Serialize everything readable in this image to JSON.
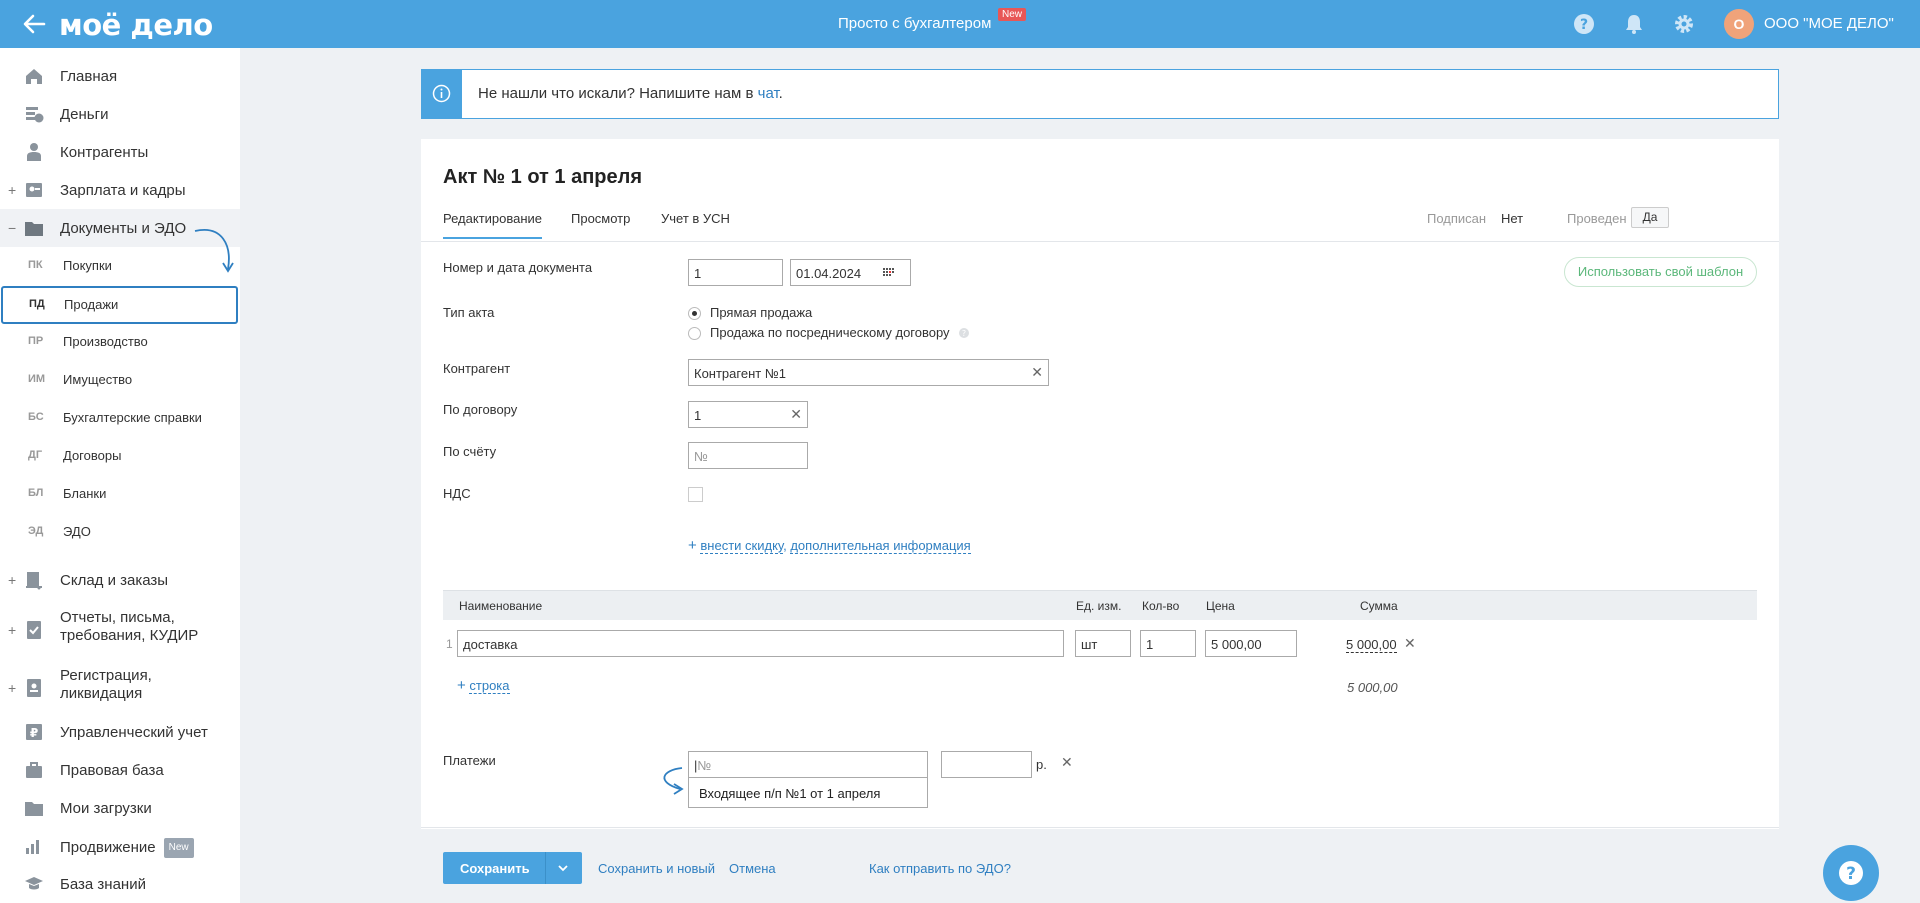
{
  "header": {
    "logo": "моё дело",
    "center_title": "Просто с бухгалтером",
    "new_badge": "New",
    "org_initial": "О",
    "org_name": "ООО \"МОЕ ДЕЛО\"",
    "icons": [
      "back-arrow-icon",
      "help-icon",
      "bell-icon",
      "gear-icon"
    ]
  },
  "sidebar": {
    "items": [
      {
        "label": "Главная",
        "icon": "home-icon"
      },
      {
        "label": "Деньги",
        "icon": "money-icon"
      },
      {
        "label": "Контрагенты",
        "icon": "contractors-icon"
      },
      {
        "label": "Зарплата и кадры",
        "icon": "salary-icon",
        "expand": "+"
      },
      {
        "label": "Документы и ЭДО",
        "icon": "documents-icon",
        "expand": "−"
      }
    ],
    "sub_items": [
      {
        "abbr": "ПК",
        "label": "Покупки"
      },
      {
        "abbr": "ПД",
        "label": "Продажи"
      },
      {
        "abbr": "ПР",
        "label": "Производство"
      },
      {
        "abbr": "ИМ",
        "label": "Имущество"
      },
      {
        "abbr": "БС",
        "label": "Бухгалтерские справки"
      },
      {
        "abbr": "ДГ",
        "label": "Договоры"
      },
      {
        "abbr": "БЛ",
        "label": "Бланки"
      },
      {
        "abbr": "ЭД",
        "label": "ЭДО"
      }
    ],
    "items2": [
      {
        "label": "Склад и заказы",
        "icon": "warehouse-icon",
        "expand": "+"
      },
      {
        "label": "Отчеты, письма,",
        "label2": "требования, КУДИР",
        "icon": "reports-icon",
        "expand": "+"
      },
      {
        "label": "Регистрация,",
        "label2": "ликвидация",
        "icon": "registration-icon",
        "expand": "+"
      },
      {
        "label": "Управленческий учет",
        "icon": "management-icon"
      },
      {
        "label": "Правовая база",
        "icon": "briefcase-icon"
      },
      {
        "label": "Мои загрузки",
        "icon": "folder-icon"
      },
      {
        "label": "Продвижение",
        "icon": "promotion-icon",
        "badge": "New"
      },
      {
        "label": "База знаний",
        "icon": "graduation-icon"
      }
    ]
  },
  "banner": {
    "text": "Не нашли что искали? Напишите нам в ",
    "link": "чат",
    "end": "."
  },
  "document": {
    "title": "Акт № 1 от 1 апреля",
    "tabs": [
      "Редактирование",
      "Просмотр",
      "Учет в УСН"
    ],
    "signed_label": "Подписан",
    "signed_value": "Нет",
    "posted_label": "Проведен",
    "posted_value": "Да",
    "template_button": "Использовать свой шаблон"
  },
  "form": {
    "number_date_label": "Номер и дата документа",
    "number_value": "1",
    "date_value": "01.04.2024",
    "act_type_label": "Тип акта",
    "act_type_options": [
      "Прямая продажа",
      "Продажа по посредническому договору"
    ],
    "act_type_selected": 0,
    "contractor_label": "Контрагент",
    "contractor_value": "Контрагент №1",
    "contract_label": "По договору",
    "contract_value": "1",
    "invoice_label": "По счёту",
    "invoice_placeholder": "№",
    "vat_label": "НДС",
    "discount_link": "внести скидку",
    "info_link": "дополнительная информация"
  },
  "table": {
    "headers": [
      "Наименование",
      "Ед. изм.",
      "Кол-во",
      "Цена",
      "Сумма"
    ],
    "rows": [
      {
        "num": "1",
        "name": "доставка",
        "unit": "шт",
        "qty": "1",
        "price": "5 000,00",
        "sum": "5 000,00"
      }
    ],
    "add_row": "строка",
    "total": "5 000,00"
  },
  "payments": {
    "label": "Платежи",
    "number_placeholder": "№",
    "currency": "р.",
    "dropdown_option": "Входящее п/п №1 от 1 апреля"
  },
  "footer": {
    "save": "Сохранить",
    "save_new": "Сохранить и новый",
    "cancel": "Отмена",
    "edo_help": "Как отправить по ЭДО?"
  },
  "colors": {
    "header_blue": "#4aa3df",
    "link_blue": "#2f7fc1",
    "green": "#5bb77a",
    "badge_red": "#e85757"
  }
}
